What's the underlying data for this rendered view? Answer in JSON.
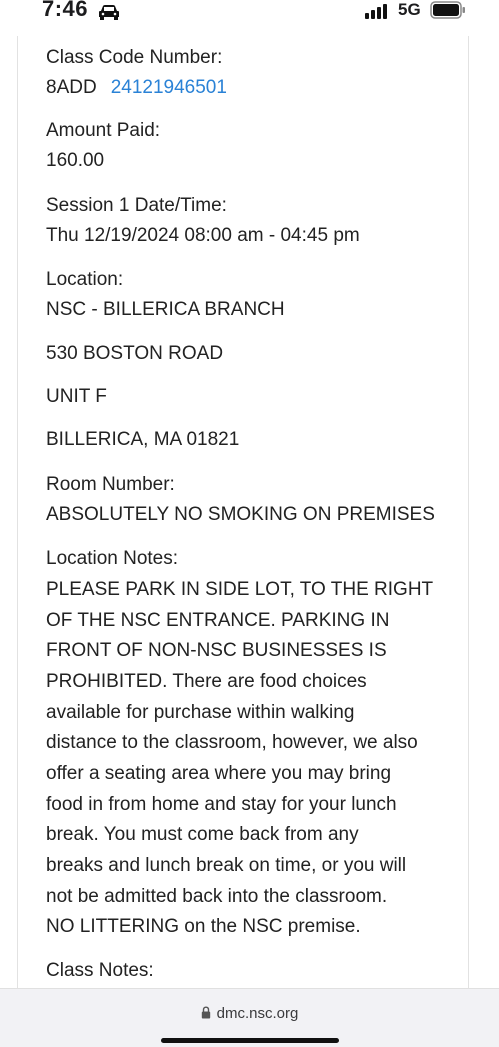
{
  "status_bar": {
    "time": "7:46",
    "network": "5G",
    "icons": [
      "car-icon",
      "signal-bars-icon",
      "battery-icon"
    ]
  },
  "details": {
    "class_code": {
      "label": "Class Code Number:",
      "prefix": "8ADD",
      "link": "24121946501"
    },
    "amount_paid": {
      "label": "Amount Paid:",
      "value": "160.00"
    },
    "session": {
      "label": "Session 1 Date/Time:",
      "value": "Thu 12/19/2024 08:00 am - 04:45 pm"
    },
    "location": {
      "label": "Location:",
      "name": "NSC - BILLERICA BRANCH",
      "street": "530 BOSTON ROAD",
      "unit": "UNIT F",
      "city": "BILLERICA, MA 01821"
    },
    "room": {
      "label": "Room Number:",
      "value": "ABSOLUTELY NO SMOKING ON PREMISES"
    },
    "location_notes": {
      "label": "Location Notes:",
      "lines": [
        "PLEASE PARK IN SIDE LOT, TO THE RIGHT",
        "OF THE NSC ENTRANCE. PARKING IN",
        "FRONT OF NON-NSC BUSINESSES IS",
        "PROHIBITED. There are food choices",
        "available for purchase within walking",
        "distance to the classroom, however, we also",
        "offer a seating area where you may bring",
        "food in from home and stay for your lunch",
        "break. You must come back from any",
        "breaks and lunch break on time, or you will",
        "not be admitted back into the classroom.",
        "NO LITTERING on the NSC premise."
      ]
    },
    "class_notes": {
      "label": "Class Notes:"
    }
  },
  "browser": {
    "url": "dmc.nsc.org"
  },
  "colors": {
    "link": "#2a82d6",
    "text": "#222222",
    "bar": "#f2f2f5"
  }
}
